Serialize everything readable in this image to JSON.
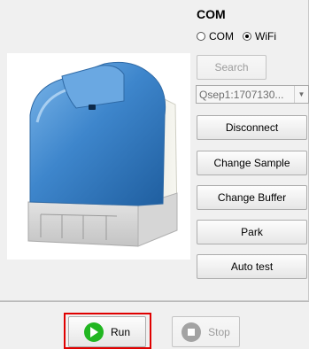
{
  "connection": {
    "title": "COM",
    "options": [
      {
        "label": "COM",
        "selected": false
      },
      {
        "label": "WiFi",
        "selected": true
      }
    ],
    "search_label": "Search",
    "device_select": {
      "selected": "Qsep1:1707130...",
      "arrow": "▼"
    }
  },
  "actions": [
    {
      "label": "Disconnect"
    },
    {
      "label": "Change Sample"
    },
    {
      "label": "Change Buffer"
    },
    {
      "label": "Park"
    },
    {
      "label": "Auto test"
    }
  ],
  "bottom_bar": {
    "run_label": "Run",
    "stop_label": "Stop"
  },
  "colors": {
    "run_icon": "#21b621",
    "stop_icon": "#a3a3a3",
    "highlight": "#e00000",
    "device_blue": "#3e86cc"
  },
  "icons": {
    "run": "play-circle-icon",
    "stop": "stop-circle-icon",
    "dropdown": "chevron-down-icon"
  }
}
